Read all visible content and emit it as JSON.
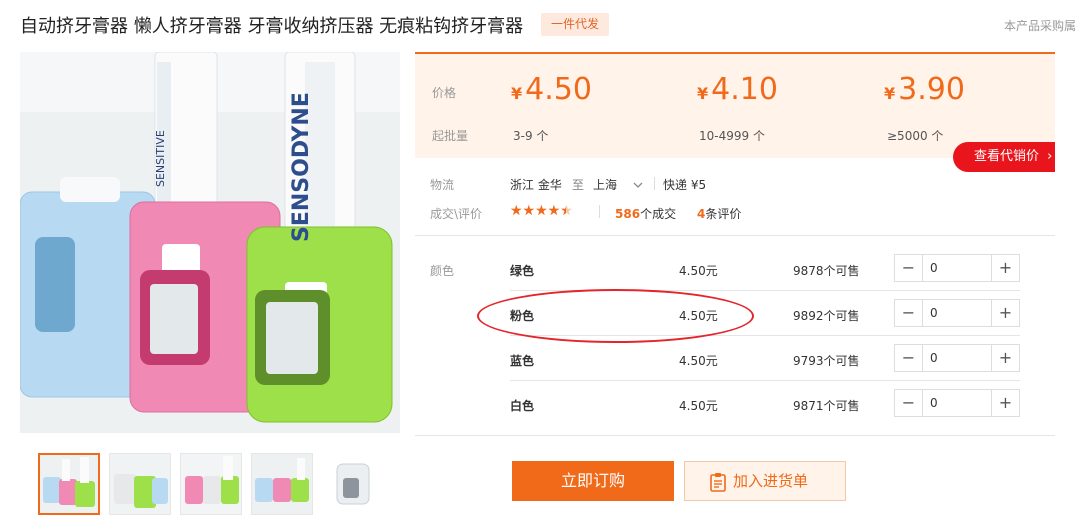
{
  "product": {
    "title": "自动挤牙膏器 懒人挤牙膏器 牙膏收纳挤压器 无痕粘钩挤牙膏器",
    "badge": "一件代发",
    "corner_note": "本产品采购属"
  },
  "pricing": {
    "price_label": "价格",
    "batch_label": "起批量",
    "currency": "¥",
    "tiers": [
      {
        "price": "4.50",
        "batch": "3-9 个"
      },
      {
        "price": "4.10",
        "batch": "10-4999 个"
      },
      {
        "price": "3.90",
        "batch": "≥5000 个"
      }
    ],
    "agent_price_button": "查看代销价"
  },
  "logistics": {
    "label": "物流",
    "from": "浙江 金华",
    "to_word": "至",
    "to": "上海",
    "shipping": "快递 ¥5"
  },
  "reviews": {
    "label": "成交\\评价",
    "rating_stars": 4.5,
    "stars_glyph": "★★★★★",
    "deals_count": "586",
    "deals_unit": "个成交",
    "review_count": "4",
    "review_unit": "条评价"
  },
  "sku": {
    "label": "颜色",
    "rows": [
      {
        "name": "绿色",
        "price": "4.50元",
        "stock": "9878个可售",
        "qty": "0"
      },
      {
        "name": "粉色",
        "price": "4.50元",
        "stock": "9892个可售",
        "qty": "0"
      },
      {
        "name": "蓝色",
        "price": "4.50元",
        "stock": "9793个可售",
        "qty": "0"
      },
      {
        "name": "白色",
        "price": "4.50元",
        "stock": "9871个可售",
        "qty": "0"
      }
    ]
  },
  "actions": {
    "buy_now": "立即订购",
    "add_to_list": "加入进货单"
  },
  "icons": {
    "dropdown": "chevron-down-icon",
    "agent_arrow": "chevron-right-icon",
    "minus": "minus-icon",
    "plus": "plus-icon",
    "cart": "clipboard-icon"
  },
  "colors": {
    "accent": "#f06a1a",
    "price_bg": "#fff3ea",
    "agent_red": "#e8151d",
    "highlight_ellipse": "#e3262b"
  }
}
